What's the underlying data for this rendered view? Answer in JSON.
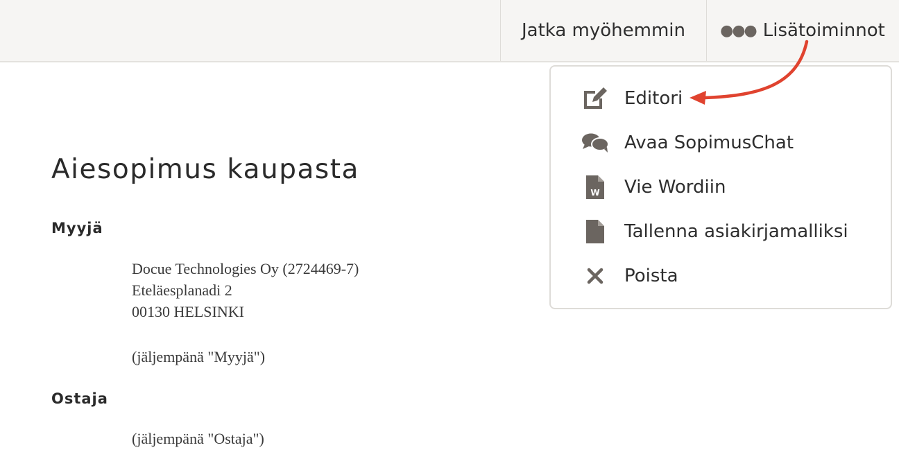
{
  "toolbar": {
    "continue_later_label": "Jatka myöhemmin",
    "more_actions_label": "Lisätoiminnot",
    "more_icon": "ellipsis-icon"
  },
  "menu": {
    "items": [
      {
        "label": "Editori",
        "icon": "edit-icon"
      },
      {
        "label": "Avaa SopimusChat",
        "icon": "chat-icon"
      },
      {
        "label": "Vie Wordiin",
        "icon": "word-file-icon"
      },
      {
        "label": "Tallenna asiakirjamalliksi",
        "icon": "file-icon"
      },
      {
        "label": "Poista",
        "icon": "close-icon"
      }
    ]
  },
  "document": {
    "title": "Aiesopimus kaupasta",
    "seller_heading": "Myyjä",
    "seller_lines": [
      "Docue Technologies Oy (2724469-7)",
      "Eteläesplanadi 2",
      "00130 HELSINKI"
    ],
    "seller_note": "(jäljempänä \"Myyjä\")",
    "buyer_heading": "Ostaja",
    "buyer_note": "(jäljempänä \"Ostaja\")"
  },
  "colors": {
    "toolbar_bg": "#f6f5f3",
    "icon_gray": "#6b6560",
    "annotation_red": "#e0432f"
  }
}
